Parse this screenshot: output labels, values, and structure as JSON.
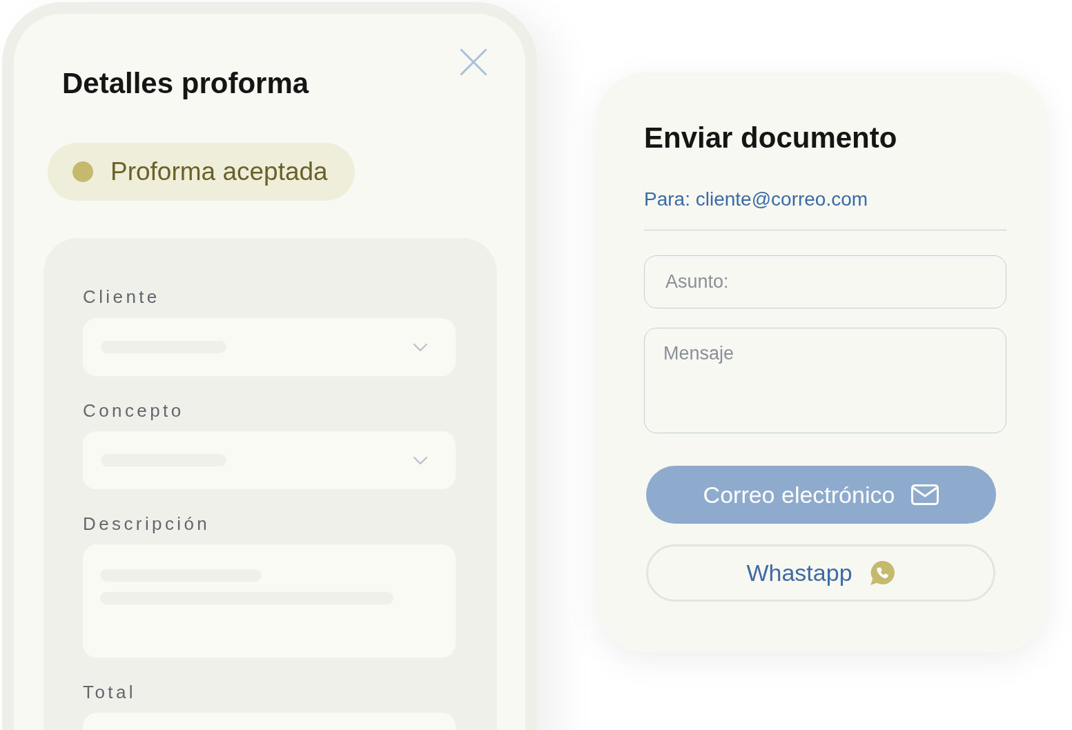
{
  "proforma_panel": {
    "title": "Detalles proforma",
    "status": {
      "label": "Proforma aceptada",
      "color": "#c4b96c"
    },
    "fields": [
      {
        "label": "Cliente",
        "kind": "select"
      },
      {
        "label": "Concepto",
        "kind": "select"
      },
      {
        "label": "Descripción",
        "kind": "textarea"
      },
      {
        "label": "Total",
        "kind": "input"
      }
    ]
  },
  "send_panel": {
    "title": "Enviar documento",
    "recipient": "Para: cliente@correo.com",
    "subject": {
      "placeholder": "Asunto:"
    },
    "message": {
      "placeholder": "Mensaje"
    },
    "buttons": [
      {
        "label": "Correo electrónico",
        "kind": "email"
      },
      {
        "label": "Whastapp",
        "kind": "whatsapp"
      }
    ]
  }
}
